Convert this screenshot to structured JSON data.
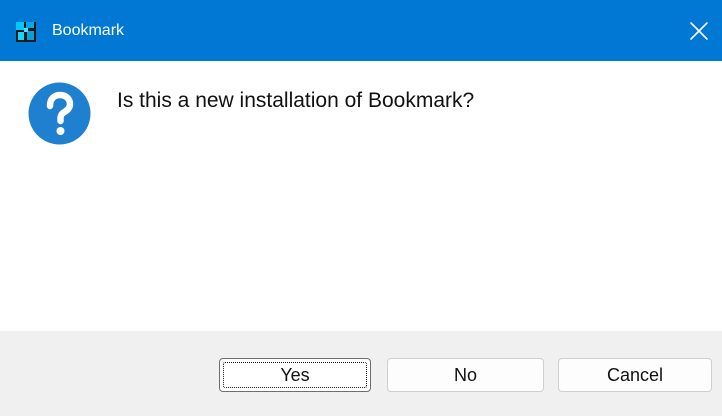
{
  "window": {
    "title": "Bookmark",
    "title_icon": "bookmark-app-icon",
    "close_icon": "close-icon",
    "accent_color": "#0078d4"
  },
  "dialog": {
    "icon": "question-icon",
    "icon_color": "#1f80d0",
    "message": "Is this a new installation of Bookmark?"
  },
  "buttons": {
    "yes": "Yes",
    "no": "No",
    "cancel": "Cancel"
  }
}
